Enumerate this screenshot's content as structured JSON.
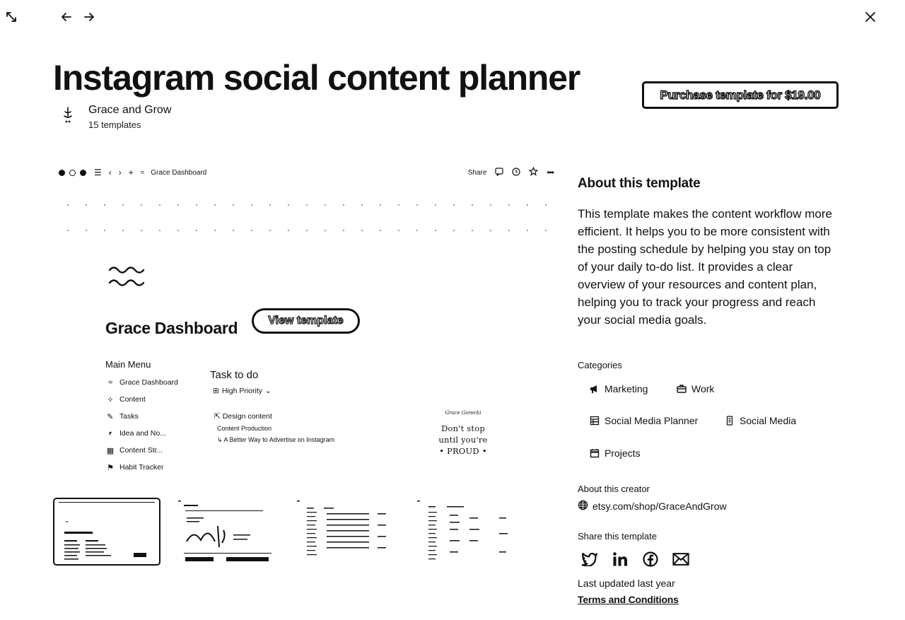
{
  "nav": {
    "expand_icon": "expand-icon",
    "back_icon": "arrow-left-icon",
    "forward_icon": "arrow-right-icon",
    "close_icon": "close-icon"
  },
  "header": {
    "title": "Instagram social content planner",
    "purchase_label": "Purchase template for $19.00"
  },
  "creator": {
    "name": "Grace and Grow",
    "templates_count": "15 templates"
  },
  "preview": {
    "breadcrumb": "Grace Dashboard",
    "share_label": "Share",
    "dashboard_title": "Grace Dashboard",
    "view_template_label": "View template",
    "menu_title": "Main Menu",
    "menu_items": [
      {
        "label": "Grace Dashboard",
        "icon": "wave-icon"
      },
      {
        "label": "Content",
        "icon": "magic-wand-icon"
      },
      {
        "label": "Tasks",
        "icon": "edit-icon"
      },
      {
        "label": "Idea and No...",
        "icon": "idea-icon"
      },
      {
        "label": "Content Str...",
        "icon": "columns-icon"
      },
      {
        "label": "Habit Tracker",
        "icon": "flag-icon"
      }
    ],
    "task_title": "Task to do",
    "task_filter": "High Priority",
    "task_rows": [
      "Design content",
      "Content Production",
      "A Better Way to Advertise on Instagram"
    ],
    "quote_signature": "Grace Gorecki",
    "quote_lines": [
      "Don't stop",
      "until you're",
      "• PROUD •"
    ]
  },
  "about": {
    "heading": "About this template",
    "description": "This template makes the content workflow more efficient. It helps you to be more consistent with the posting schedule by helping you stay on top of your daily to-do list. It provides a clear overview of your resources and content plan, helping you to track your progress and reach your social media goals."
  },
  "categories": {
    "label": "Categories",
    "items": [
      {
        "label": "Marketing",
        "icon": "megaphone-icon"
      },
      {
        "label": "Work",
        "icon": "briefcase-icon"
      },
      {
        "label": "Social Media Planner",
        "icon": "calendar-grid-icon"
      },
      {
        "label": "Social Media",
        "icon": "phone-icon"
      },
      {
        "label": "Projects",
        "icon": "calendar-icon"
      }
    ]
  },
  "creator_info": {
    "label": "About this creator",
    "link": "etsy.com/shop/GraceAndGrow"
  },
  "share": {
    "label": "Share this template",
    "icons": [
      "twitter-icon",
      "linkedin-icon",
      "facebook-icon",
      "email-icon"
    ]
  },
  "footer": {
    "updated": "Last updated last year",
    "terms": "Terms and Conditions"
  }
}
